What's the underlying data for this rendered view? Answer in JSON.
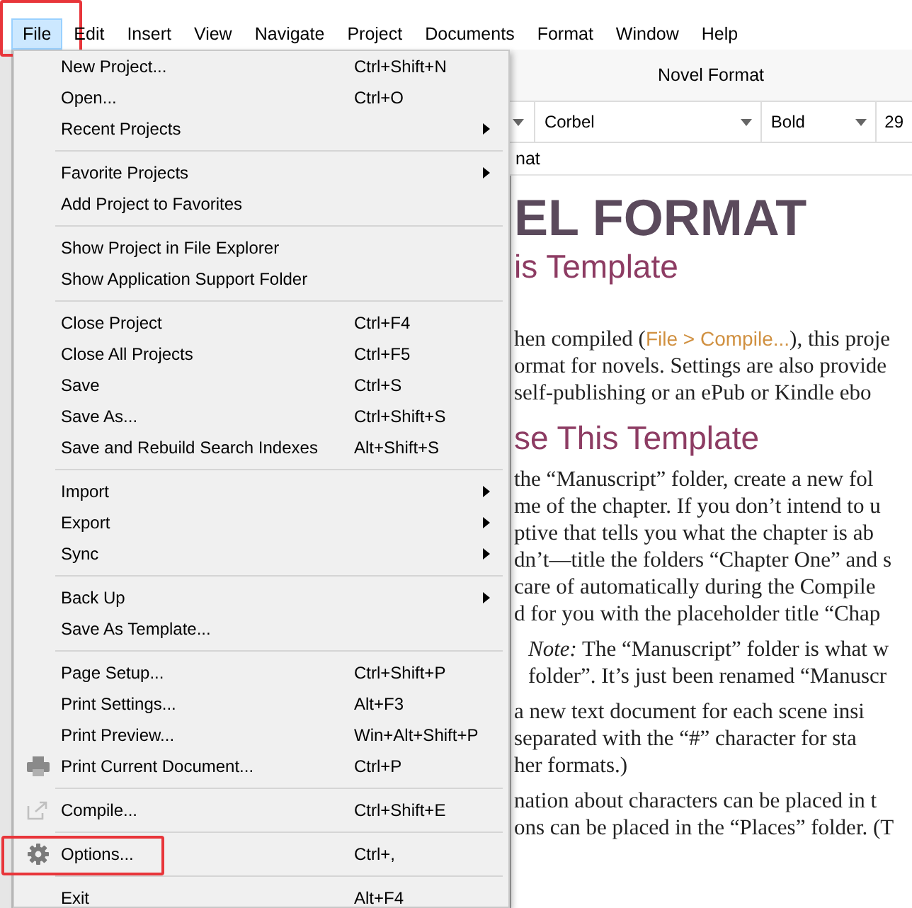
{
  "menubar": [
    {
      "label": "File",
      "selected": true,
      "annotated": true
    },
    {
      "label": "Edit",
      "selected": false,
      "annotated": false
    },
    {
      "label": "Insert",
      "selected": false,
      "annotated": false
    },
    {
      "label": "View",
      "selected": false,
      "annotated": false
    },
    {
      "label": "Navigate",
      "selected": false,
      "annotated": false
    },
    {
      "label": "Project",
      "selected": false,
      "annotated": false
    },
    {
      "label": "Documents",
      "selected": false,
      "annotated": false
    },
    {
      "label": "Format",
      "selected": false,
      "annotated": false
    },
    {
      "label": "Window",
      "selected": false,
      "annotated": false
    },
    {
      "label": "Help",
      "selected": false,
      "annotated": false
    }
  ],
  "file_menu": [
    {
      "kind": "item",
      "label": "New Project...",
      "shortcut": "Ctrl+Shift+N",
      "submenu": false,
      "annotated": false
    },
    {
      "kind": "item",
      "label": "Open...",
      "shortcut": "Ctrl+O",
      "submenu": false,
      "annotated": false
    },
    {
      "kind": "item",
      "label": "Recent Projects",
      "submenu": true,
      "annotated": false
    },
    {
      "kind": "separator"
    },
    {
      "kind": "item",
      "label": "Favorite Projects",
      "submenu": true,
      "annotated": false
    },
    {
      "kind": "item",
      "label": "Add Project to Favorites",
      "submenu": false,
      "annotated": false
    },
    {
      "kind": "separator"
    },
    {
      "kind": "item",
      "label": "Show Project in File Explorer",
      "submenu": false,
      "annotated": false
    },
    {
      "kind": "item",
      "label": "Show Application Support Folder",
      "submenu": false,
      "annotated": false
    },
    {
      "kind": "separator"
    },
    {
      "kind": "item",
      "label": "Close Project",
      "shortcut": "Ctrl+F4",
      "submenu": false,
      "annotated": false
    },
    {
      "kind": "item",
      "label": "Close All Projects",
      "shortcut": "Ctrl+F5",
      "submenu": false,
      "annotated": false
    },
    {
      "kind": "item",
      "label": "Save",
      "shortcut": "Ctrl+S",
      "submenu": false,
      "annotated": false
    },
    {
      "kind": "item",
      "label": "Save As...",
      "shortcut": "Ctrl+Shift+S",
      "submenu": false,
      "annotated": false
    },
    {
      "kind": "item",
      "label": "Save and Rebuild Search Indexes",
      "shortcut": "Alt+Shift+S",
      "submenu": false,
      "annotated": false
    },
    {
      "kind": "separator"
    },
    {
      "kind": "item",
      "label": "Import",
      "submenu": true,
      "annotated": false
    },
    {
      "kind": "item",
      "label": "Export",
      "submenu": true,
      "annotated": false
    },
    {
      "kind": "item",
      "label": "Sync",
      "submenu": true,
      "annotated": false
    },
    {
      "kind": "separator"
    },
    {
      "kind": "item",
      "label": "Back Up",
      "submenu": true,
      "annotated": false
    },
    {
      "kind": "item",
      "label": "Save As Template...",
      "submenu": false,
      "annotated": false
    },
    {
      "kind": "separator"
    },
    {
      "kind": "item",
      "label": "Page Setup...",
      "shortcut": "Ctrl+Shift+P",
      "submenu": false,
      "annotated": false
    },
    {
      "kind": "item",
      "label": "Print Settings...",
      "shortcut": "Alt+F3",
      "submenu": false,
      "annotated": false
    },
    {
      "kind": "item",
      "label": "Print Preview...",
      "shortcut": "Win+Alt+Shift+P",
      "submenu": false,
      "annotated": false
    },
    {
      "kind": "printer-item",
      "label": "Print Current Document...",
      "shortcut": "Ctrl+P",
      "submenu": false,
      "annotated": false
    },
    {
      "kind": "separator"
    },
    {
      "kind": "export-item",
      "label": "Compile...",
      "shortcut": "Ctrl+Shift+E",
      "submenu": false,
      "annotated": false
    },
    {
      "kind": "separator"
    },
    {
      "kind": "gear-item",
      "label": "Options...",
      "shortcut": "Ctrl+,",
      "submenu": false,
      "annotated": true
    },
    {
      "kind": "separator"
    },
    {
      "kind": "item",
      "label": "Exit",
      "shortcut": "Alt+F4",
      "submenu": false,
      "annotated": false
    }
  ],
  "editor": {
    "title": "Novel Format",
    "format_bar": [
      {
        "kind": "stub"
      },
      {
        "kind": "dropdown",
        "value": "Corbel"
      },
      {
        "kind": "dropdown",
        "value": "Bold"
      },
      {
        "kind": "field",
        "value": "29"
      }
    ],
    "header_fragment": "nat",
    "blocks": [
      {
        "kind": "title",
        "lines": [
          "EL FORMAT"
        ]
      },
      {
        "kind": "heading",
        "lines": [
          "is Template"
        ]
      },
      {
        "kind": "body",
        "lines": [
          "hen compiled (**File > Compile...**), this proje",
          "ormat for novels. Settings are also provide",
          "self-publishing or an ePub or Kindle ebo"
        ]
      },
      {
        "kind": "heading",
        "lines": [
          "se This Template"
        ]
      },
      {
        "kind": "body",
        "lines": [
          "the “Manuscript” folder, create a new fol",
          "me of the chapter. If you don’t intend to u",
          "ptive that tells you what the chapter is ab",
          "dn’t—title the folders “Chapter One” and s",
          "care of automatically during the Compile",
          "d for you with the placeholder title “Chap"
        ]
      },
      {
        "kind": "note",
        "lines": [
          "*Note:* The “Manuscript” folder is what w",
          "folder”. It’s just been renamed “Manuscr"
        ]
      },
      {
        "kind": "body",
        "lines": [
          "a new text document for each scene insi",
          "separated with the “#” character for sta",
          "her formats.)"
        ]
      },
      {
        "kind": "body",
        "lines": [
          "nation about characters can be placed in t",
          "ons can be placed in the “Places” folder. (T"
        ]
      }
    ]
  }
}
